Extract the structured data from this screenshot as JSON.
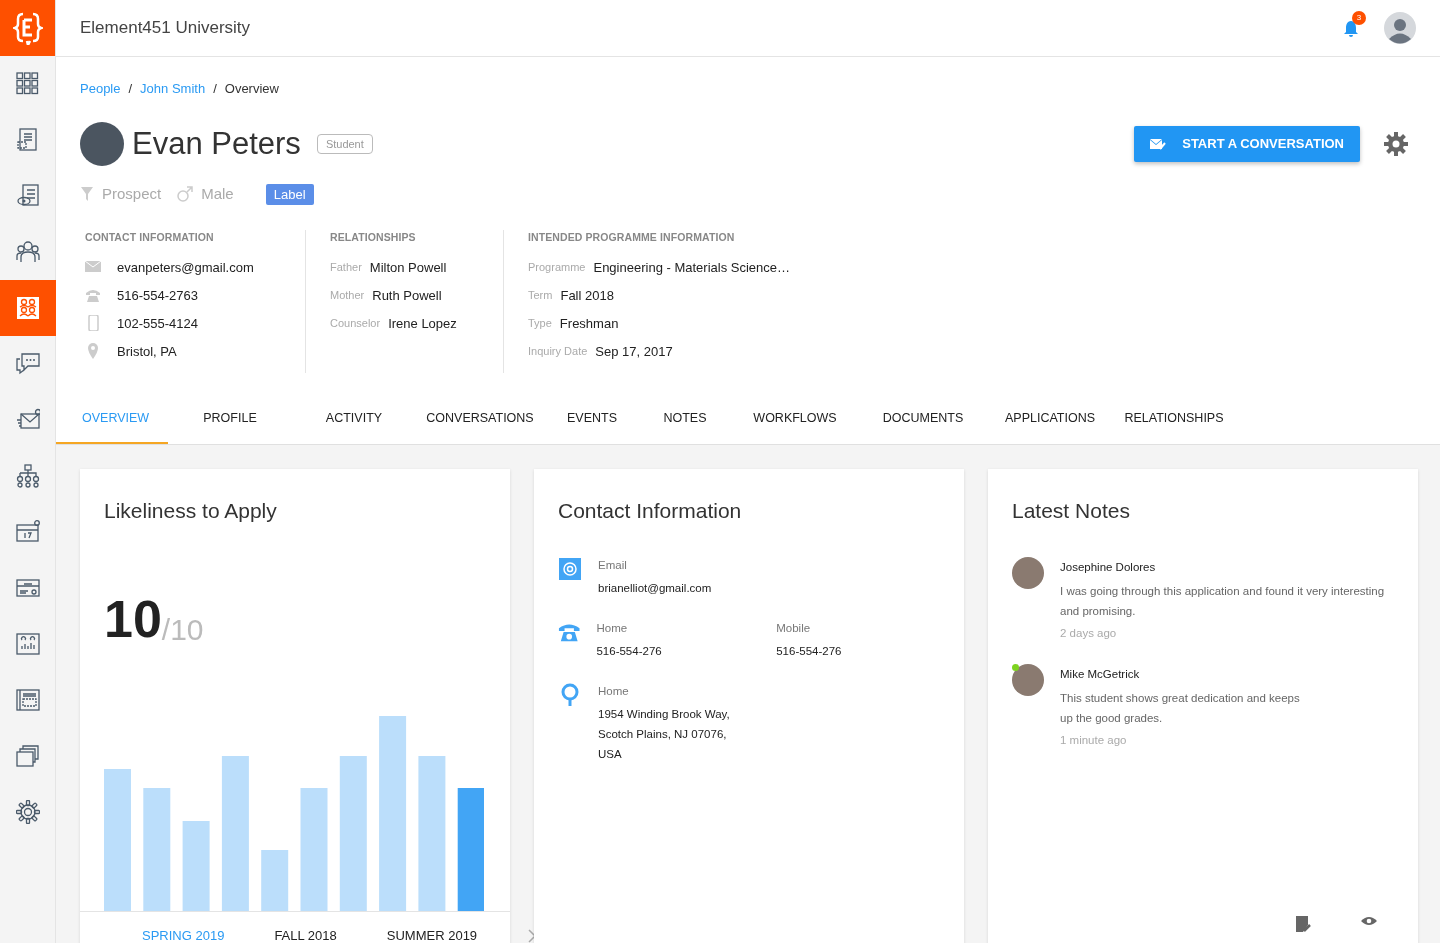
{
  "app": {
    "title": "Element451 University",
    "notifications": "3"
  },
  "sidebar": {
    "items": [
      {
        "selected": false
      },
      {
        "selected": false
      },
      {
        "selected": false
      },
      {
        "selected": false
      },
      {
        "selected": true
      },
      {
        "selected": false
      },
      {
        "selected": false
      },
      {
        "selected": false
      },
      {
        "selected": false
      },
      {
        "selected": false
      },
      {
        "selected": false
      },
      {
        "selected": false
      },
      {
        "selected": false
      },
      {
        "selected": false
      }
    ]
  },
  "breadcrumb": [
    {
      "label": "People",
      "link": true
    },
    {
      "separator": "/",
      "label": "John Smith",
      "link": true
    },
    {
      "separator": "/",
      "label": "Overview",
      "link": false
    }
  ],
  "profile": {
    "name": "Evan Peters",
    "role": "Student",
    "stage": "Prospect",
    "gender": "Male",
    "label": "Label",
    "action": "START A CONVERSATION"
  },
  "contact_information": {
    "heading": "CONTACT INFORMATION",
    "items": [
      {
        "kind": "email",
        "value": "evanpeters@gmail.com"
      },
      {
        "kind": "phone",
        "value": "516-554-2763"
      },
      {
        "kind": "mobile",
        "value": "102-555-4124"
      },
      {
        "kind": "location",
        "value": "Bristol, PA"
      }
    ]
  },
  "relationships": {
    "heading": "RELATIONSHIPS",
    "items": [
      {
        "label": "Father",
        "value": "Milton Powell"
      },
      {
        "label": "Mother",
        "value": "Ruth Powell"
      },
      {
        "label": "Counselor",
        "value": "Irene Lopez"
      }
    ]
  },
  "programme": {
    "heading": "INTENDED PROGRAMME INFORMATION",
    "items": [
      {
        "label": "Programme",
        "value": "Engineering - Materials Science…"
      },
      {
        "label": "Term",
        "value": "Fall 2018"
      },
      {
        "label": "Type",
        "value": "Freshman"
      },
      {
        "label": "Inquiry Date",
        "value": "Sep 17, 2017"
      }
    ]
  },
  "tabs": [
    {
      "label": "OVERVIEW",
      "selected": true
    },
    {
      "label": "PROFILE",
      "selected": false
    },
    {
      "label": "ACTIVITY",
      "selected": false
    },
    {
      "label": "CONVERSATIONS",
      "selected": false
    },
    {
      "label": "EVENTS",
      "selected": false
    },
    {
      "label": "NOTES",
      "selected": false
    },
    {
      "label": "WORKFLOWS",
      "selected": false
    },
    {
      "label": "DOCUMENTS",
      "selected": false
    },
    {
      "label": "APPLICATIONS",
      "selected": false
    },
    {
      "label": "RELATIONSHIPS",
      "selected": false
    }
  ],
  "likeliness": {
    "title": "Likeliness to Apply",
    "score": "10",
    "out_of": "/10",
    "periods": [
      {
        "label": "SPRING 2019",
        "selected": true
      },
      {
        "label": "FALL 2018",
        "selected": false
      },
      {
        "label": "SUMMER 2019",
        "selected": false
      }
    ]
  },
  "contact_card": {
    "title": "Contact Information",
    "email": {
      "label": "Email",
      "value": "brianelliot@gmail.com"
    },
    "phones": [
      {
        "label": "Home",
        "value": "516-554-276"
      },
      {
        "label": "Mobile",
        "value": "516-554-276"
      }
    ],
    "address": {
      "label": "Home",
      "lines": [
        "1954 Winding Brook Way,",
        "Scotch Plains, NJ 07076,",
        "USA"
      ]
    }
  },
  "notes_card": {
    "title": "Latest Notes",
    "notes": [
      {
        "author": "Josephine Dolores",
        "lines": [
          "I was going through this application and found it very interesting",
          "and promising."
        ],
        "time": "2 days ago",
        "online": false
      },
      {
        "author": "Mike McGetrick",
        "lines": [
          "This student shows great dedication and keeps",
          "up the good grades."
        ],
        "time": "1 minute ago",
        "online": true
      }
    ]
  }
}
